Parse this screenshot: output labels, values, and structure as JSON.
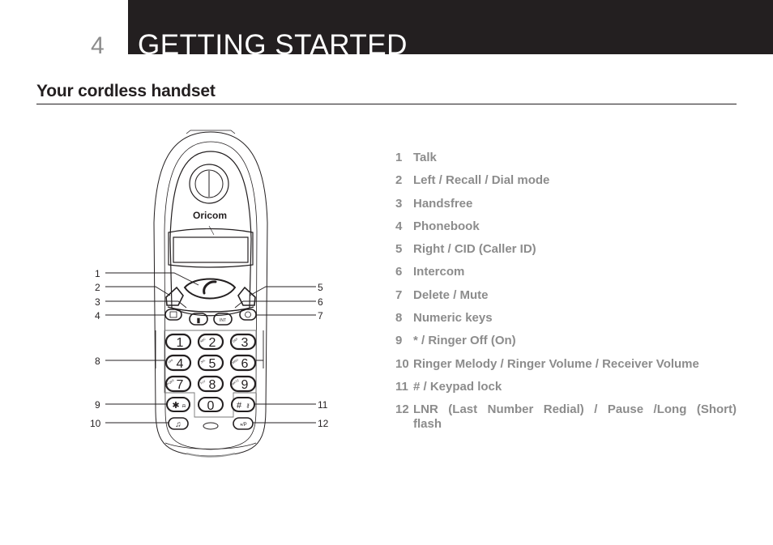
{
  "header": {
    "chapter_number": "4",
    "chapter_title": "GETTING STARTED"
  },
  "section": {
    "title": "Your cordless handset"
  },
  "phone": {
    "brand": "Oricom",
    "keys": [
      {
        "digit": "1",
        "letters": ""
      },
      {
        "digit": "2",
        "letters": "ABC"
      },
      {
        "digit": "3",
        "letters": "DEF"
      },
      {
        "digit": "4",
        "letters": "GHI"
      },
      {
        "digit": "5",
        "letters": "JKL"
      },
      {
        "digit": "6",
        "letters": "MNO"
      },
      {
        "digit": "7",
        "letters": "PQRS"
      },
      {
        "digit": "8",
        "letters": "TUV"
      },
      {
        "digit": "9",
        "letters": "WXYZ"
      },
      {
        "digit": "0",
        "letters": ""
      }
    ],
    "star_key": "✱",
    "hash_key": "#",
    "int_key": "INT",
    "lnr_key": "◑/P",
    "callouts_left": [
      "1",
      "2",
      "3",
      "4",
      "8",
      "9",
      "10"
    ],
    "callouts_right": [
      "5",
      "6",
      "7",
      "11",
      "12"
    ]
  },
  "legend": [
    {
      "num": "1",
      "text": "Talk"
    },
    {
      "num": "2",
      "text": "Left / Recall / Dial mode"
    },
    {
      "num": "3",
      "text": "Handsfree"
    },
    {
      "num": "4",
      "text": "Phonebook"
    },
    {
      "num": "5",
      "text": "Right / CID (Caller ID)"
    },
    {
      "num": "6",
      "text": "Intercom"
    },
    {
      "num": "7",
      "text": "Delete / Mute"
    },
    {
      "num": "8",
      "text": "Numeric keys"
    },
    {
      "num": "9",
      "text": "* / Ringer Off (On)"
    },
    {
      "num": "10",
      "text": "Ringer Melody / Ringer Volume / Receiver Volume"
    },
    {
      "num": "11",
      "text": "# / Keypad lock"
    },
    {
      "num": "12",
      "text": "LNR (Last Number Redial) / Pause /Long (Short) flash"
    }
  ]
}
